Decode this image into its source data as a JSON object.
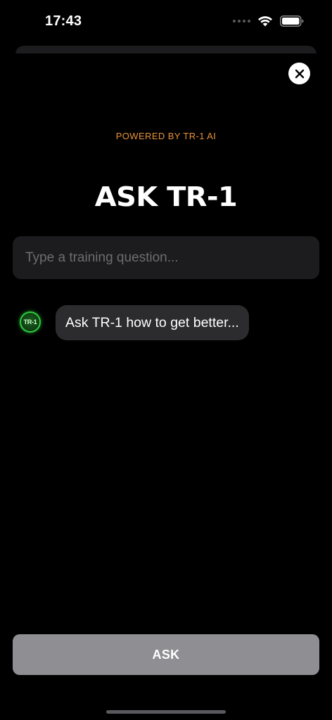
{
  "status_bar": {
    "time": "17:43",
    "icons": [
      "signal-icon",
      "wifi-icon",
      "battery-icon"
    ]
  },
  "header": {
    "close_icon": "close-icon",
    "powered_by": "POWERED BY TR-1 AI",
    "title": "ASK TR-1"
  },
  "question": {
    "placeholder": "Type a training question...",
    "value": ""
  },
  "chat": {
    "avatar_label": "TR-1",
    "bubble_text": "Ask TR-1 how to get better..."
  },
  "actions": {
    "ask_label": "ASK"
  },
  "colors": {
    "background": "#000000",
    "accent": "#e8923a",
    "avatar_green": "#2ecc40",
    "button_disabled": "#8e8e93",
    "input_bg": "#1c1c1e",
    "bubble_bg": "#2c2c2e"
  }
}
